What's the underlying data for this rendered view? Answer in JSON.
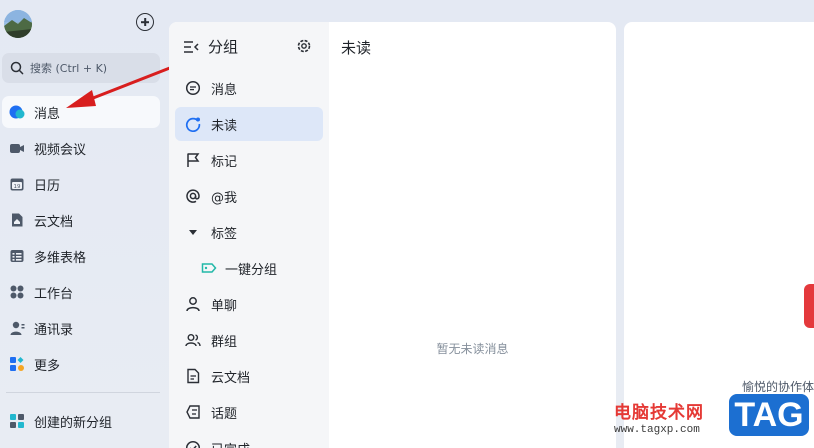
{
  "search": {
    "placeholder": "搜索 (Ctrl + K)"
  },
  "nav": {
    "items": [
      {
        "label": "消息",
        "icon": "message-bubble-icon",
        "active": true
      },
      {
        "label": "视频会议",
        "icon": "video-camera-icon"
      },
      {
        "label": "日历",
        "icon": "calendar-icon",
        "calendar_day": "19"
      },
      {
        "label": "云文档",
        "icon": "cloud-doc-icon"
      },
      {
        "label": "多维表格",
        "icon": "table-icon"
      },
      {
        "label": "工作台",
        "icon": "grid-apps-icon"
      },
      {
        "label": "通讯录",
        "icon": "contacts-icon"
      },
      {
        "label": "更多",
        "icon": "more-apps-icon"
      }
    ],
    "new_group": "创建的新分组"
  },
  "groups": {
    "title": "分组",
    "items": [
      {
        "label": "消息",
        "icon": "chat-icon"
      },
      {
        "label": "未读",
        "icon": "unread-icon",
        "active": true
      },
      {
        "label": "标记",
        "icon": "flag-icon"
      },
      {
        "label": "@我",
        "icon": "at-icon"
      },
      {
        "label": "标签",
        "icon": "caret-down-icon"
      },
      {
        "label": "一键分组",
        "icon": "tag-icon"
      },
      {
        "label": "单聊",
        "icon": "person-icon"
      },
      {
        "label": "群组",
        "icon": "group-icon"
      },
      {
        "label": "云文档",
        "icon": "doc-icon"
      },
      {
        "label": "话题",
        "icon": "topic-icon"
      },
      {
        "label": "已完成",
        "icon": "check-icon"
      }
    ]
  },
  "list": {
    "title": "未读",
    "empty_text": "暂无未读消息"
  },
  "right": {
    "collab_text": "愉悦的协作体"
  },
  "watermark": {
    "site_name": "电脑技术网",
    "url": "www.tagxp.com",
    "tag": "TAG"
  },
  "colors": {
    "accent": "#1f6ff2",
    "active_bg": "#dde7f8",
    "arrow": "#d81e1e"
  }
}
